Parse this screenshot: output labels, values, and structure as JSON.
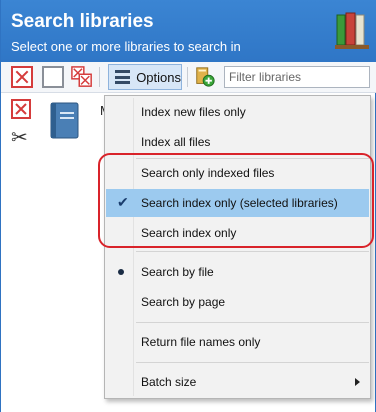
{
  "header": {
    "title": "Search libraries",
    "subtitle": "Select one or more libraries to search in"
  },
  "toolbar": {
    "options_label": "Options",
    "filter_placeholder": "Filter libraries"
  },
  "library": {
    "name_visible": "M"
  },
  "menu": {
    "items": [
      {
        "label": "Index new files only"
      },
      {
        "label": "Index all files"
      },
      {
        "label": "Search only indexed files"
      },
      {
        "label": "Search index only (selected libraries)",
        "checked": true,
        "highlighted": true
      },
      {
        "label": "Search index only"
      },
      {
        "label": "Search by file",
        "radio_selected": true
      },
      {
        "label": "Search by page"
      },
      {
        "label": "Return file names only"
      },
      {
        "label": "Batch size",
        "has_submenu": true
      }
    ]
  },
  "colors": {
    "header_blue": "#3b85d3",
    "menu_highlight": "#9ccaef",
    "annotation_red": "#d9232a"
  }
}
